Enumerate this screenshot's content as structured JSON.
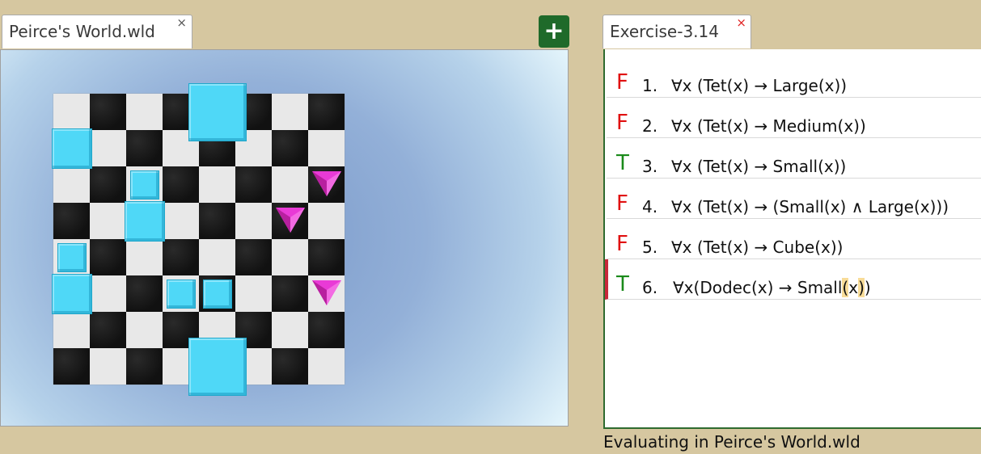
{
  "world_tab": {
    "title": "Peirce's World.wld",
    "close": "×"
  },
  "add_button": {
    "label": "+"
  },
  "exercise_tab": {
    "title": "Exercise-3.14",
    "close": "×"
  },
  "colors": {
    "cube": "#4fd8f7",
    "tet": "#e93ad6",
    "true": "#1a8a1a",
    "false": "#e01010"
  },
  "world": {
    "objects": [
      {
        "shape": "cube",
        "size": "large",
        "col": 4,
        "row": 1
      },
      {
        "shape": "cube",
        "size": "medium",
        "col": 0,
        "row": 2
      },
      {
        "shape": "cube",
        "size": "small",
        "col": 2,
        "row": 3
      },
      {
        "shape": "tet",
        "size": "small",
        "col": 7,
        "row": 3
      },
      {
        "shape": "cube",
        "size": "medium",
        "col": 2,
        "row": 4
      },
      {
        "shape": "tet",
        "size": "small",
        "col": 6,
        "row": 4
      },
      {
        "shape": "cube",
        "size": "small",
        "col": 0,
        "row": 5
      },
      {
        "shape": "cube",
        "size": "medium",
        "col": 0,
        "row": 6
      },
      {
        "shape": "cube",
        "size": "small",
        "col": 3,
        "row": 6
      },
      {
        "shape": "cube",
        "size": "small",
        "col": 4,
        "row": 6
      },
      {
        "shape": "tet",
        "size": "small",
        "col": 7,
        "row": 6
      },
      {
        "shape": "cube",
        "size": "large",
        "col": 4,
        "row": 8
      }
    ]
  },
  "sentences": [
    {
      "value": "F",
      "number": "1.",
      "text": "∀x (Tet(x) → Large(x))"
    },
    {
      "value": "F",
      "number": "2.",
      "text": "∀x (Tet(x) → Medium(x))"
    },
    {
      "value": "T",
      "number": "3.",
      "text": "∀x (Tet(x) → Small(x))"
    },
    {
      "value": "F",
      "number": "4.",
      "text": "∀x (Tet(x) → (Small(x) ∧ Large(x)))"
    },
    {
      "value": "F",
      "number": "5.",
      "text": "∀x (Tet(x) → Cube(x))"
    },
    {
      "value": "T",
      "number": "6.",
      "text_pre": "∀x(Dodec(x) → Small",
      "text_hl1": "(",
      "text_mid": "x",
      "text_hl2": ")",
      "text_post": ")"
    }
  ],
  "status": "Evaluating in Peirce's World.wld"
}
